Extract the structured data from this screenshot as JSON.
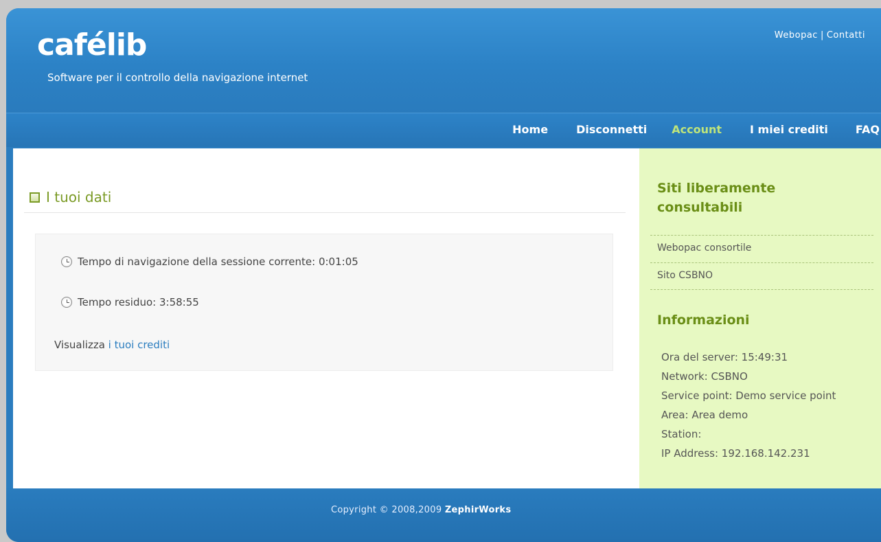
{
  "header": {
    "logo": "cafélib",
    "tagline": "Software per il controllo della navigazione internet",
    "top_links": {
      "webopac": "Webopac",
      "separator": "|",
      "contatti": "Contatti"
    }
  },
  "nav": {
    "home": "Home",
    "disconnetti": "Disconnetti",
    "account": "Account",
    "crediti": "I miei crediti",
    "faq": "FAQ"
  },
  "main": {
    "section_title": "I tuoi dati",
    "session_time": "Tempo di navigazione della sessione corrente: 0:01:05",
    "remaining_time": "Tempo residuo: 3:58:55",
    "view_prefix": "Visualizza ",
    "view_link": "i tuoi crediti"
  },
  "sidebar": {
    "free_sites_title": "Siti liberamente consultabili",
    "free_sites": [
      "Webopac consortile",
      "Sito CSBNO"
    ],
    "info_title": "Informazioni",
    "info_lines": [
      "Ora del server: 15:49:31",
      "Network: CSBNO",
      "Service point: Demo service point",
      "Area: Area demo",
      "Station:",
      "IP Address: 192.168.142.231"
    ]
  },
  "footer": {
    "copyright_prefix": "Copyright © 2008,2009 ",
    "company": "ZephirWorks"
  },
  "colors": {
    "brand_blue": "#2b7dbf",
    "accent_green": "#7a9a24",
    "sidebar_bg": "#e7f9c2"
  }
}
